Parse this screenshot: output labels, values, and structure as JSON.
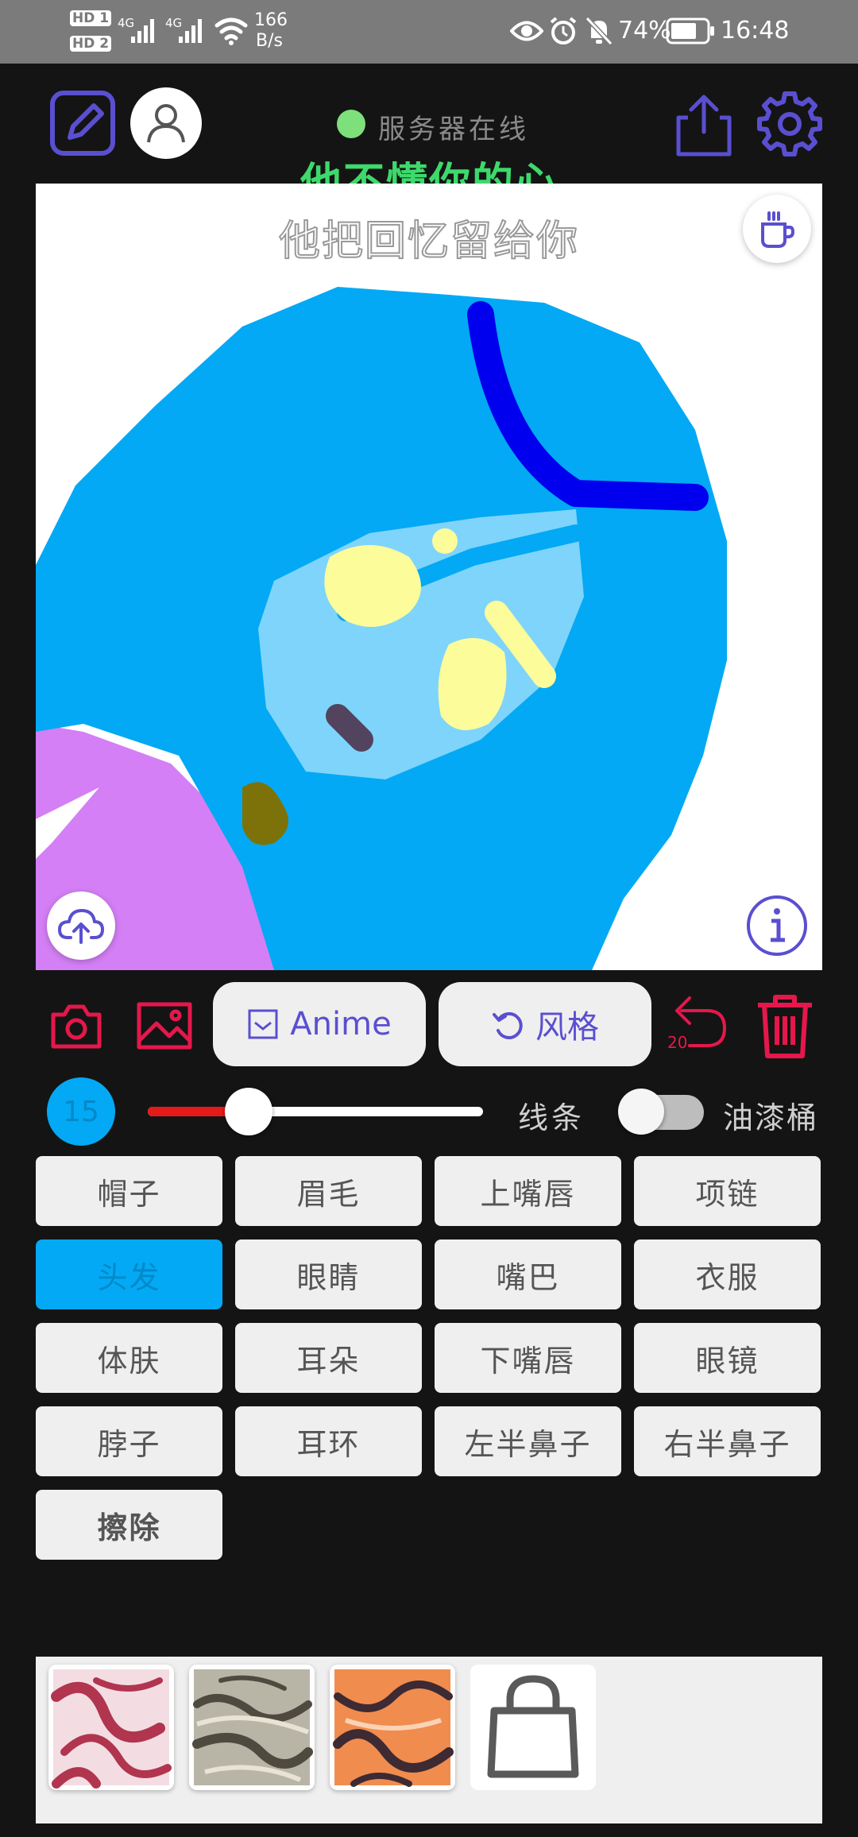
{
  "status_bar": {
    "sim1": "HD 1",
    "sim2": "HD 2",
    "net1": "4G",
    "net2": "4G",
    "speed_value": "166",
    "speed_unit": "B/s",
    "battery": "74%",
    "time": "16:48"
  },
  "header": {
    "server_status": "服务器在线",
    "server_status_color": "#7ee07a",
    "lyric_current": "他不懂你的心",
    "lyric_next": "他把回忆留给你",
    "accent": "#5a4fd0"
  },
  "toolbar": {
    "anime_label": "Anime",
    "style_label": "风格",
    "undo_count": "20",
    "danger_color": "#e5174b"
  },
  "brush": {
    "size": "15",
    "level": 0.3,
    "lines_label": "线条",
    "bucket_label": "油漆桶",
    "bucket_on": false
  },
  "parts": [
    {
      "label": "帽子",
      "active": false
    },
    {
      "label": "眉毛",
      "active": false
    },
    {
      "label": "上嘴唇",
      "active": false
    },
    {
      "label": "项链",
      "active": false
    },
    {
      "label": "头发",
      "active": true
    },
    {
      "label": "眼睛",
      "active": false
    },
    {
      "label": "嘴巴",
      "active": false
    },
    {
      "label": "衣服",
      "active": false
    },
    {
      "label": "体肤",
      "active": false
    },
    {
      "label": "耳朵",
      "active": false
    },
    {
      "label": "下嘴唇",
      "active": false
    },
    {
      "label": "眼镜",
      "active": false
    },
    {
      "label": "脖子",
      "active": false
    },
    {
      "label": "耳环",
      "active": false
    },
    {
      "label": "左半鼻子",
      "active": false
    },
    {
      "label": "右半鼻子",
      "active": false
    },
    {
      "label": "擦除",
      "active": false
    }
  ],
  "icons": {
    "edit": "edit-icon",
    "avatar": "user-icon",
    "share": "share-icon",
    "settings": "gear-icon",
    "coffee": "coffee-icon",
    "upload": "cloud-upload-icon",
    "info": "info-icon",
    "camera": "camera-icon",
    "gallery": "image-icon",
    "undo": "undo-icon",
    "delete": "trash-icon",
    "shop": "shopping-bag-icon"
  },
  "style_swatches": [
    "swatch-red-marble",
    "swatch-gray-marble",
    "swatch-orange-marble"
  ]
}
